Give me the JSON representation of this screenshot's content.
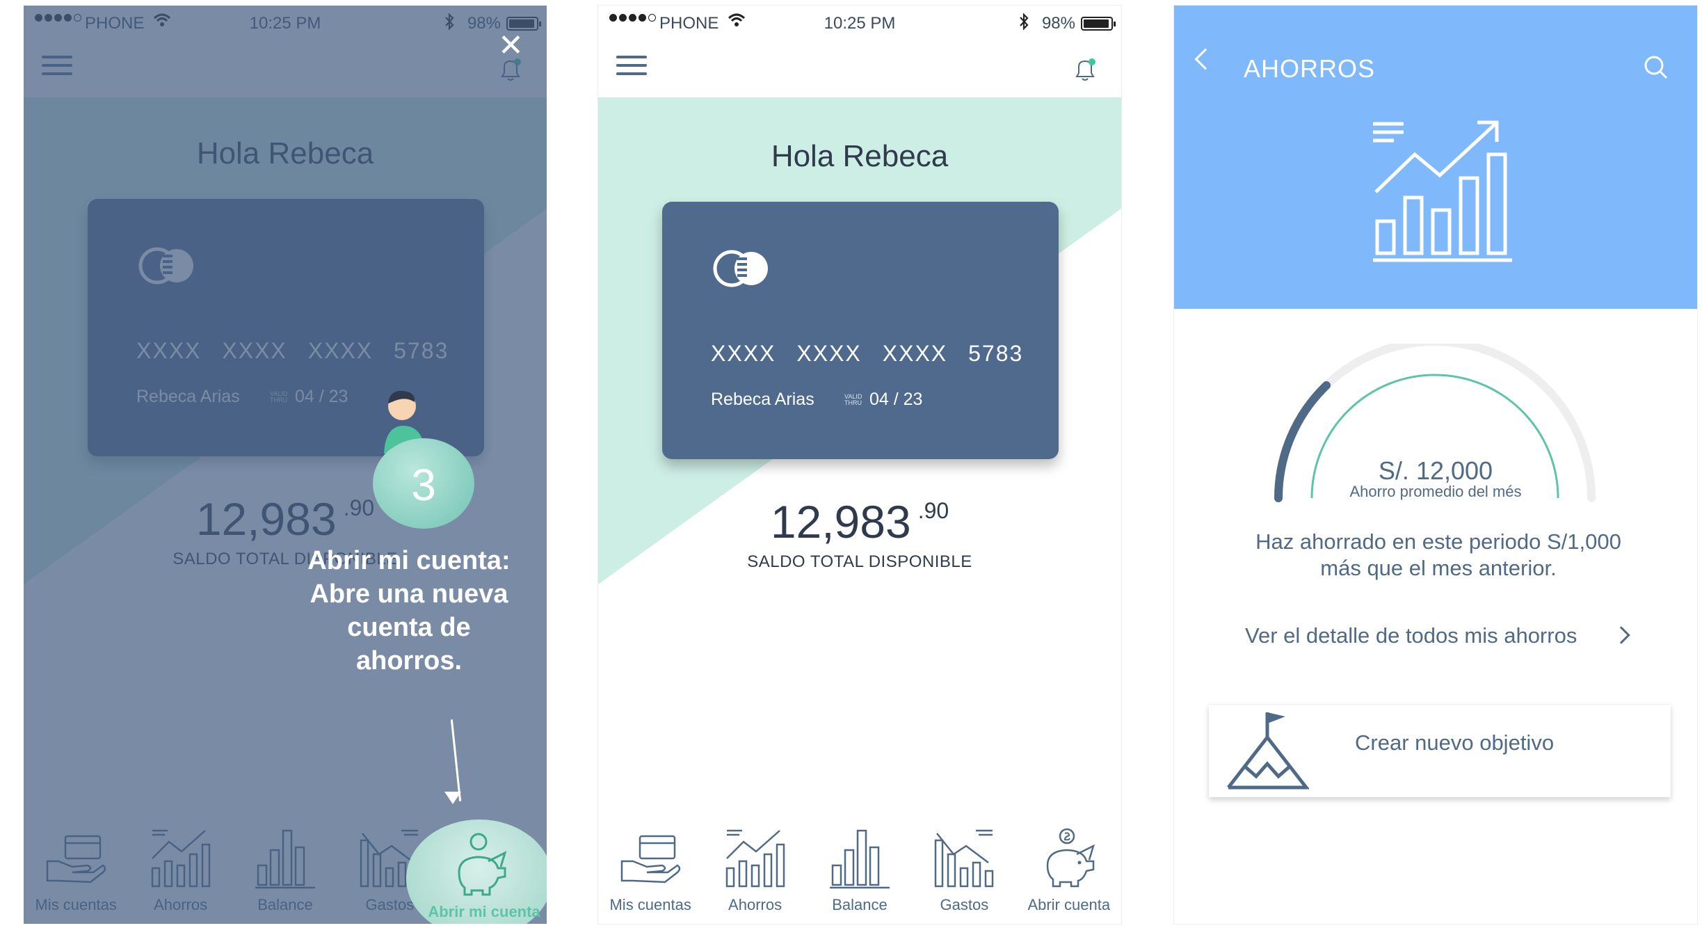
{
  "status_bar": {
    "carrier": "PHONE",
    "time": "10:25 PM",
    "battery": "98%"
  },
  "home": {
    "greeting": "Hola Rebeca",
    "card": {
      "number_groups": [
        "XXXX",
        "XXXX",
        "XXXX",
        "5783"
      ],
      "holder": "Rebeca Arias",
      "valid_label": "VALID THRU",
      "expiry": "04 / 23"
    },
    "balance": {
      "amount": "12,983",
      "cents": ".90",
      "label": "SALDO TOTAL DISPONIBLE"
    },
    "tabs": [
      {
        "label": "Mis cuentas",
        "icon": "hand-card-icon"
      },
      {
        "label": "Ahorros",
        "icon": "growth-chart-icon"
      },
      {
        "label": "Balance",
        "icon": "bar-chart-icon"
      },
      {
        "label": "Gastos",
        "icon": "decline-chart-icon"
      },
      {
        "label": "Abrir cuenta",
        "icon": "piggy-bank-icon"
      }
    ]
  },
  "onboarding": {
    "step": "3",
    "tip": "Abrir mi cuenta: Abre una nueva cuenta de ahorros.",
    "spotlight_label": "Abrir mi cuenta"
  },
  "savings": {
    "title": "AHORROS",
    "gauge_amount": "S/.  12,000",
    "gauge_caption": "Ahorro promedio del més",
    "message": "Haz ahorrado en este periodo S/1,000 más que el mes anterior.",
    "detail_link": "Ver el detalle de todos mis ahorros",
    "new_goal": "Crear nuevo objetivo"
  },
  "colors": {
    "teal_light": "#cdeee4",
    "card_blue": "#4f6a8c",
    "header_blue": "#7fb8fb",
    "text_slate": "#4f6a86",
    "accent_green": "#5cc4a8"
  }
}
